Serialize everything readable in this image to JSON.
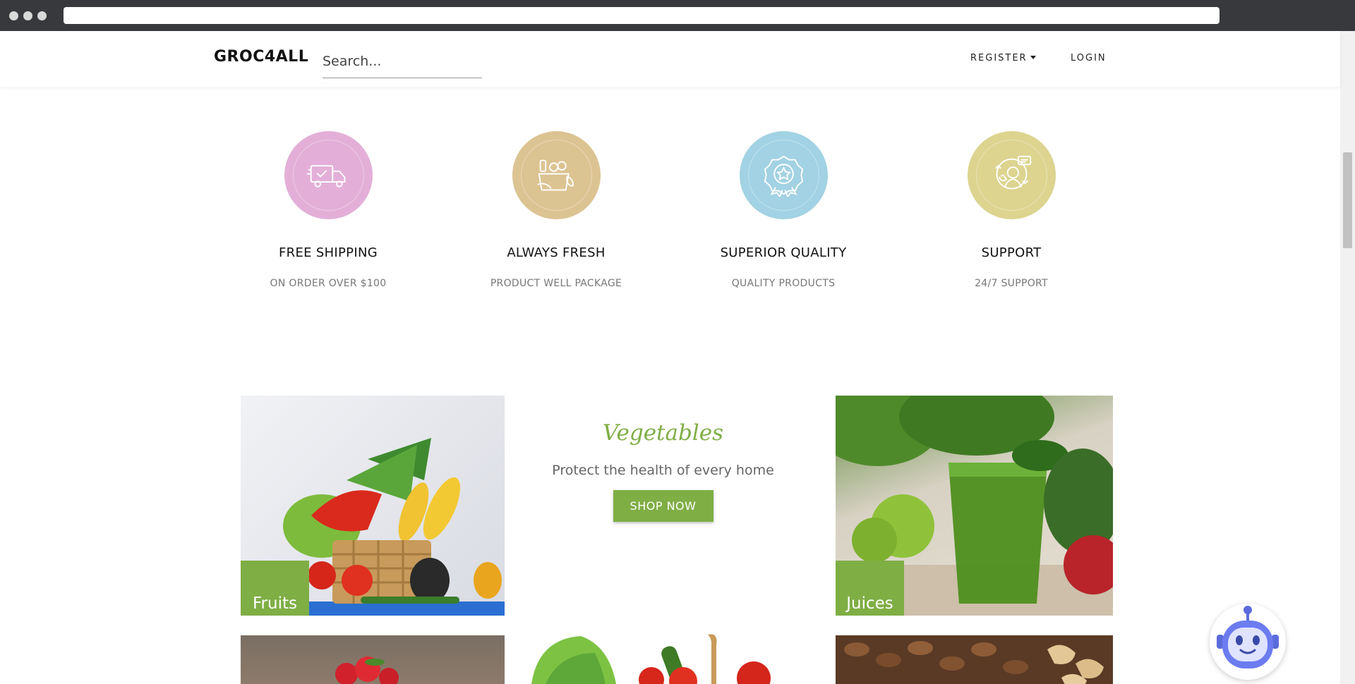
{
  "navbar": {
    "brand": "GROC4ALL",
    "search_placeholder": "Search...",
    "register_label": "REGISTER",
    "login_label": "LOGIN"
  },
  "features": [
    {
      "title": "FREE SHIPPING",
      "subtitle": "ON ORDER OVER $100",
      "color": "#e3afd8",
      "icon": "delivery-truck-icon"
    },
    {
      "title": "ALWAYS FRESH",
      "subtitle": "PRODUCT WELL PACKAGE",
      "color": "#dcc392",
      "icon": "grocery-basket-icon"
    },
    {
      "title": "SUPERIOR QUALITY",
      "subtitle": "QUALITY PRODUCTS",
      "color": "#a2d2e3",
      "icon": "quality-badge-icon"
    },
    {
      "title": "SUPPORT",
      "subtitle": "24/7 SUPPORT",
      "color": "#dcd48f",
      "icon": "support-agent-icon"
    }
  ],
  "categories": {
    "fruits_label": "Fruits",
    "juices_label": "Juices",
    "center_title": "Vegetables",
    "center_subtitle": "Protect the health of every home",
    "shop_now_label": "SHOP NOW"
  },
  "colors": {
    "accent": "#7fae45"
  }
}
